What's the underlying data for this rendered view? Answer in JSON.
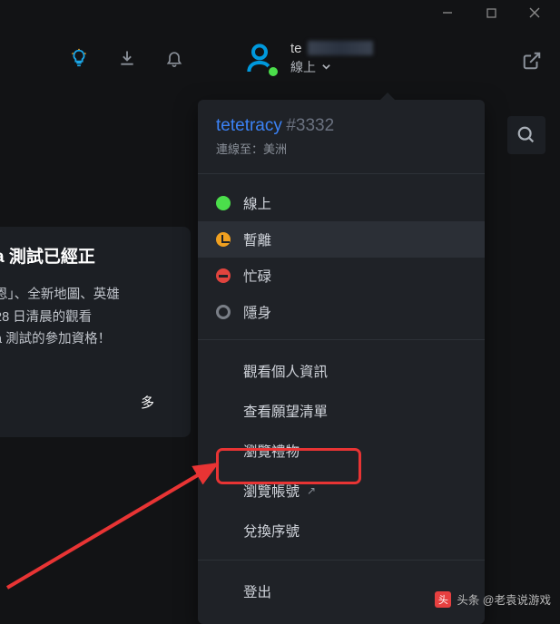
{
  "titlebar": {
    "min": "—",
    "max": "▢",
    "close": "✕"
  },
  "header": {
    "user_name_prefix": "te",
    "status_label": "線上"
  },
  "dropdown": {
    "username": "tetetracy",
    "tag": "#3332",
    "region_label": "連線至：美洲",
    "statuses": [
      {
        "label": "線上",
        "kind": "online",
        "selected": false
      },
      {
        "label": "暫離",
        "kind": "away",
        "selected": true
      },
      {
        "label": "忙碌",
        "kind": "busy",
        "selected": false
      },
      {
        "label": "隱身",
        "kind": "invisible",
        "selected": false
      }
    ],
    "menu1": [
      {
        "label": "觀看個人資訊"
      },
      {
        "label": "查看願望清單"
      },
      {
        "label": "瀏覽禮物"
      },
      {
        "label": "瀏覽帳號",
        "external": true
      },
      {
        "label": "兌換序號"
      }
    ],
    "menu2": [
      {
        "label": "登出"
      }
    ]
  },
  "background_card": {
    "title": "a 測試已經正",
    "line1": "恩」、全新地圖、英雄",
    "line2": "28 日清晨的觀看",
    "line3": "a 測試的參加資格！",
    "more": "多"
  },
  "watermark": {
    "badge": "头",
    "text": "头条 @老袁说游戏"
  }
}
